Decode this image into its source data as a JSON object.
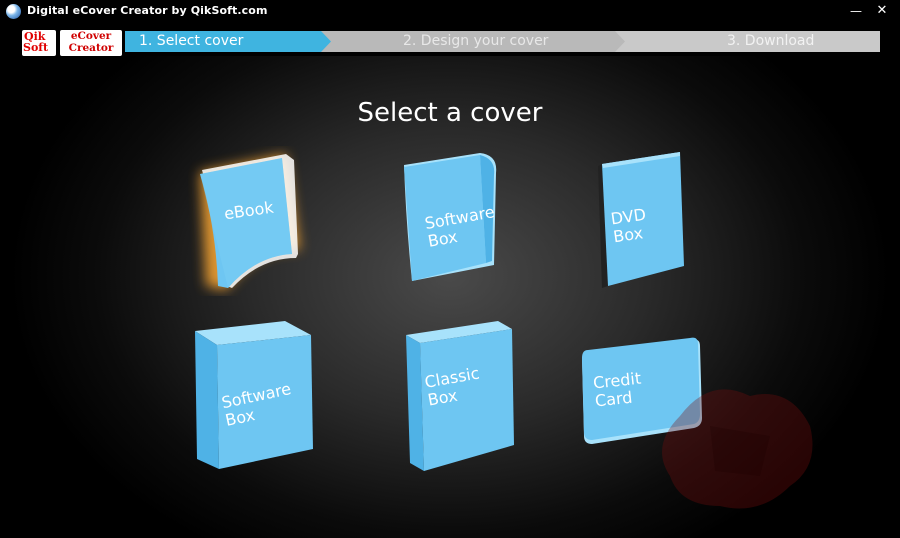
{
  "window": {
    "title": "Digital eCover Creator by QikSoft.com",
    "minimize_glyph": "—",
    "close_glyph": "✕"
  },
  "logos": {
    "qiksoft_line1": "Qik",
    "qiksoft_line2": "Soft",
    "ecover_line1": "eCover",
    "ecover_line2": "Creator"
  },
  "wizard": {
    "steps": [
      {
        "label": "1. Select cover",
        "state": "active",
        "color": "#3fb4e0"
      },
      {
        "label": "2. Design your cover",
        "state": "inactive",
        "color": "#b9b9b9"
      },
      {
        "label": "3. Download",
        "state": "inactive",
        "color": "#c9c9c9"
      }
    ]
  },
  "main": {
    "heading": "Select a cover",
    "covers": [
      {
        "label": "eBook",
        "selected": true,
        "icon": "ebook-cover-icon"
      },
      {
        "label": "Software\nBox",
        "selected": false,
        "icon": "software-box-cover-icon"
      },
      {
        "label": "DVD\nBox",
        "selected": false,
        "icon": "dvd-box-cover-icon"
      },
      {
        "label": "Software\nBox",
        "selected": false,
        "icon": "software-box-3d-cover-icon"
      },
      {
        "label": "Classic\nBox",
        "selected": false,
        "icon": "classic-box-cover-icon"
      },
      {
        "label": "Credit\nCard",
        "selected": false,
        "icon": "credit-card-cover-icon"
      }
    ]
  },
  "colors": {
    "cover_face": "#6ec6f2",
    "cover_edge": "#a8e2fb",
    "cover_dark": "#3a9fd6",
    "selection_glow": "#f0a030"
  }
}
